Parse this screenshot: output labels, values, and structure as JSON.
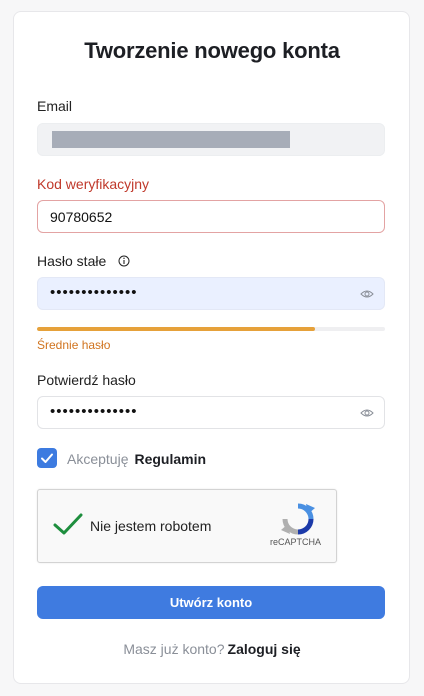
{
  "page": {
    "title": "Tworzenie nowego konta"
  },
  "email": {
    "label": "Email"
  },
  "verification": {
    "label": "Kod weryfikacyjny",
    "value": "90780652"
  },
  "password": {
    "label": "Hasło stałe",
    "masked": "••••••••••••••",
    "strength_text": "Średnie hasło",
    "strength_fraction": 0.8
  },
  "confirm": {
    "label": "Potwierdź hasło",
    "masked": "••••••••••••••"
  },
  "terms": {
    "accept_text": "Akceptuję",
    "link_text": "Regulamin",
    "checked": true
  },
  "captcha": {
    "text": "Nie jestem robotem",
    "brand": "reCAPTCHA"
  },
  "submit": {
    "label": "Utwórz konto"
  },
  "login": {
    "prompt": "Masz już konto?",
    "link_text": "Zaloguj się"
  },
  "icons": {
    "info": "info-icon",
    "eye": "eye-icon",
    "check": "checkmark-icon",
    "captcha_logo": "recaptcha-logo-icon"
  },
  "colors": {
    "primary": "#3f7be0",
    "error": "#c0392b",
    "strength": "#e6a13a"
  }
}
